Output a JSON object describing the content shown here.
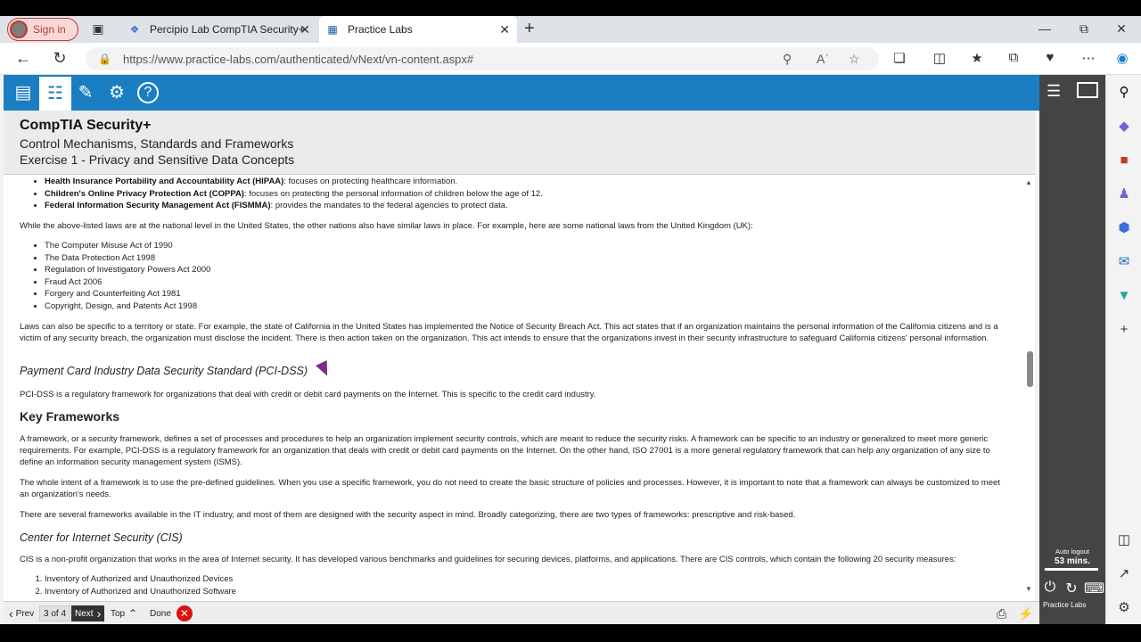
{
  "browser": {
    "signin_label": "Sign in",
    "tabs": [
      {
        "title": "Percipio Lab CompTIA Security+",
        "icon": "percipio-icon"
      },
      {
        "title": "Practice Labs",
        "icon": "practice-labs-icon"
      }
    ],
    "url": "https://www.practice-labs.com/authenticated/vNext/vn-content.aspx#"
  },
  "header": {
    "course": "CompTIA Security+",
    "module": "Control Mechanisms, Standards and Frameworks",
    "exercise": "Exercise 1 - Privacy and Sensitive Data Concepts"
  },
  "content": {
    "us_laws": [
      {
        "name": "Health Insurance Portability and Accountability Act (HIPAA)",
        "desc": ": focuses on protecting healthcare information."
      },
      {
        "name": "Children's Online Privacy Protection Act (COPPA)",
        "desc": ": focuses on protecting the personal information of children below the age of 12."
      },
      {
        "name": "Federal Information Security Management Act (FISMMA)",
        "desc": ": provides the mandates to the federal agencies to protect data."
      }
    ],
    "p_uk_intro": "While the above-listed laws are at the national level in the United States, the other nations also have similar laws in place. For example, here are some national laws from the United Kingdom (UK):",
    "uk_laws": [
      "The Computer Misuse Act of 1990",
      "The Data Protection Act 1998",
      "Regulation of Investigatory Powers Act 2000",
      "Fraud Act 2006",
      "Forgery and Counterfeiting Act 1981",
      "Copyright, Design, and Patents Act 1998"
    ],
    "p_territory": "Laws can also be specific to a territory or state. For example, the state of California in the United States has implemented the Notice of Security Breach Act. This act states that if an organization maintains the personal information of the California citizens and is a victim of any security breach, the organization must disclose the incident. There is then action taken on the organization. This act intends to ensure that the organizations invest in their security infrastructure to safeguard California citizens' personal information.",
    "h_pcidss": "Payment Card Industry Data Security Standard (PCI-DSS)",
    "p_pcidss": "PCI-DSS is a regulatory framework for organizations that deal with credit or debit card payments on the Internet. This is specific to the credit card industry.",
    "h_frameworks": "Key Frameworks",
    "p_fw1": "A framework, or a security framework, defines a set of processes and procedures to help an organization implement security controls, which are meant to reduce the security risks. A framework can be specific to an industry or generalized to meet more generic requirements. For example, PCI-DSS is a regulatory framework for an organization that deals with credit or debit card payments on the Internet. On the other hand, ISO 27001 is a more general regulatory framework that can help any organization of any size to define an information security management system (ISMS).",
    "p_fw2": "The whole intent of a framework is to use the pre-defined guidelines. When you use a specific framework, you do not need to create the basic structure of policies and processes. However, it is important to note that a framework can always be customized to meet an organization's needs.",
    "p_fw3": "There are several frameworks available in the IT industry, and most of them are designed with the security aspect in mind. Broadly categorizing, there are two types of frameworks: prescriptive and risk-based.",
    "h_cis": "Center for Internet Security (CIS)",
    "p_cis": "CIS is a non-profit organization that works in the area of Internet security. It has developed various benchmarks and guidelines for securing devices, platforms, and applications. There are CIS controls, which contain the following 20 security measures:",
    "cis_list": [
      "Inventory of Authorized and Unauthorized Devices",
      "Inventory of Authorized and Unauthorized Software"
    ]
  },
  "nav": {
    "prev": "Prev",
    "page": "3 of 4",
    "next": "Next",
    "top": "Top",
    "done": "Done"
  },
  "panel": {
    "autologout_label": "Auto logout",
    "autologout_value": "53 mins.",
    "brand": "Practice Labs"
  },
  "colors": {
    "toolbar": "#1b7ec2",
    "panel": "#444444",
    "done": "#dd1111"
  }
}
